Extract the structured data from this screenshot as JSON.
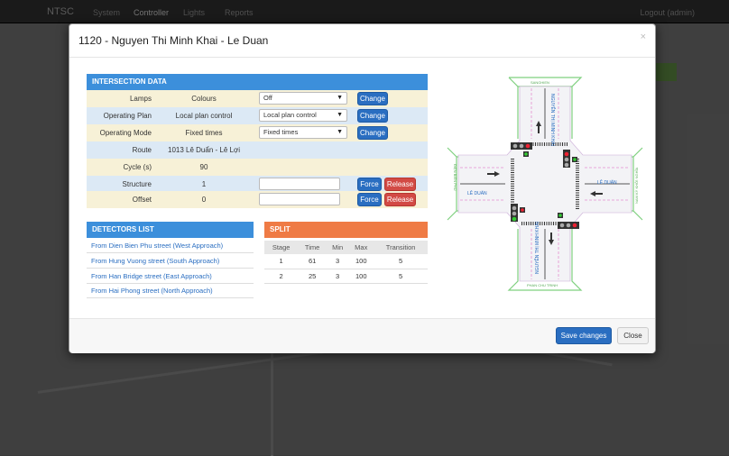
{
  "navbar": {
    "brand": "NTSC",
    "items": [
      "System",
      "Controller",
      "Lights",
      "Reports"
    ],
    "logout": "Logout (admin)"
  },
  "modal": {
    "title": "1120 - Nguyen Thi Minh Khai - Le Duan",
    "close_icon": "×",
    "save_label": "Save changes",
    "close_label": "Close"
  },
  "intersection": {
    "heading": "INTERSECTION DATA",
    "rows": [
      {
        "label": "Lamps",
        "value": "Colours",
        "select": "Off",
        "button": "Change"
      },
      {
        "label": "Operating Plan",
        "value": "Local plan control",
        "select": "Local plan control",
        "button": "Change"
      },
      {
        "label": "Operating Mode",
        "value": "Fixed times",
        "select": "Fixed times",
        "button": "Change"
      },
      {
        "label": "Route",
        "value": "1013 Lê Duẩn - Lê Lợi"
      },
      {
        "label": "Cycle (s)",
        "value": "90"
      },
      {
        "label": "Structure",
        "value": "1",
        "force": "Force",
        "release": "Release"
      },
      {
        "label": "Offset",
        "value": "0",
        "force": "Force",
        "release": "Release"
      }
    ]
  },
  "detectors": {
    "heading": "DETECTORS LIST",
    "items": [
      "From Dien Bien Phu street (West Approach)",
      "From Hung Vuong street (South Approach)",
      "From Han Bridge street (East Approach)",
      "From Hai Phong street (North Approach)"
    ]
  },
  "split": {
    "heading": "SPLIT",
    "columns": [
      "Stage",
      "Time",
      "Min",
      "Max",
      "Transition"
    ],
    "rows": [
      [
        "1",
        "61",
        "3",
        "100",
        "5"
      ],
      [
        "2",
        "25",
        "3",
        "100",
        "5"
      ]
    ]
  },
  "diagram": {
    "west_label": "LÊ DUẨN",
    "east_label": "LÊ DUẨN",
    "north_label": "NGUYỄN THỊ MINH KHAI",
    "south_label": "NGUYỄN THỊ MINH KHAI",
    "north_street": "SANGHIEN",
    "south_street": "PHAN CHU TRINH",
    "west_street": "ĐIỆN BIÊN PHỦ",
    "east_street": "NAM KỲ KHỞI NGHĨA"
  }
}
